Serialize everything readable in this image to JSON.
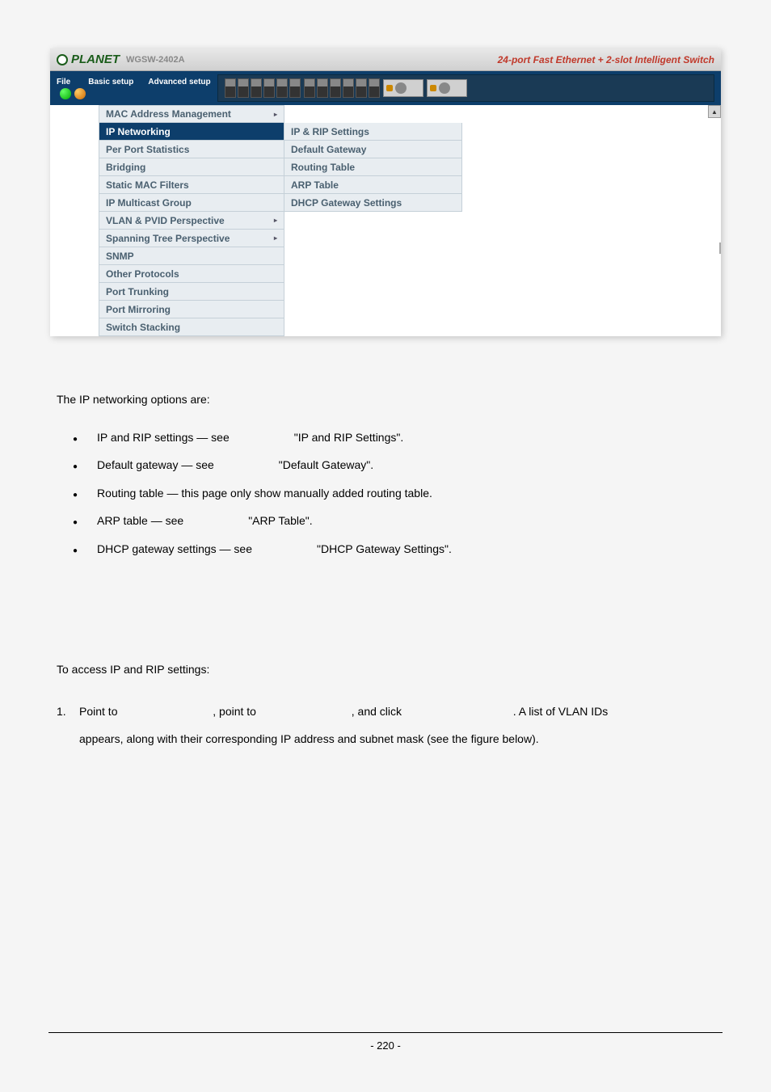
{
  "app": {
    "logo_text": "PLANET",
    "model": "WGSW-2402A",
    "tagline": "24-port Fast Ethernet + 2-slot Intelligent Switch",
    "menu_file": "File",
    "menu_basic": "Basic setup",
    "menu_advanced": "Advanced setup"
  },
  "menu": {
    "items": [
      {
        "label": "MAC Address Management",
        "has_sub": true,
        "highlighted": false
      },
      {
        "label": "IP Networking",
        "has_sub": false,
        "highlighted": true
      },
      {
        "label": "Per Port Statistics",
        "has_sub": false,
        "highlighted": false
      },
      {
        "label": "Bridging",
        "has_sub": false,
        "highlighted": false
      },
      {
        "label": "Static MAC Filters",
        "has_sub": false,
        "highlighted": false
      },
      {
        "label": "IP Multicast Group",
        "has_sub": false,
        "highlighted": false
      },
      {
        "label": "VLAN & PVID Perspective",
        "has_sub": true,
        "highlighted": false
      },
      {
        "label": "Spanning Tree Perspective",
        "has_sub": true,
        "highlighted": false
      },
      {
        "label": "SNMP",
        "has_sub": false,
        "highlighted": false
      },
      {
        "label": "Other Protocols",
        "has_sub": false,
        "highlighted": false
      },
      {
        "label": "Port Trunking",
        "has_sub": false,
        "highlighted": false
      },
      {
        "label": "Port Mirroring",
        "has_sub": false,
        "highlighted": false
      },
      {
        "label": "Switch Stacking",
        "has_sub": false,
        "highlighted": false
      }
    ]
  },
  "submenu": {
    "items": [
      {
        "label": "IP & RIP Settings"
      },
      {
        "label": "Default Gateway"
      },
      {
        "label": "Routing Table"
      },
      {
        "label": "ARP Table"
      },
      {
        "label": "DHCP Gateway Settings"
      }
    ]
  },
  "doc": {
    "intro": "The IP networking options are:",
    "bullets": [
      {
        "label": "IP and RIP settings — see",
        "ref": "\"IP and RIP Settings\"."
      },
      {
        "label": "Default gateway — see",
        "ref": "\"Default Gateway\"."
      },
      {
        "label": "Routing table — this page only show manually added routing table.",
        "ref": ""
      },
      {
        "label": "ARP table — see",
        "ref": "\"ARP Table\"."
      },
      {
        "label": "DHCP gateway settings — see",
        "ref": "\"DHCP Gateway Settings\"."
      }
    ],
    "subhead": "To access IP and RIP settings:",
    "step1_a": "Point to",
    "step1_b": ", point to",
    "step1_c": ", and click",
    "step1_d": ". A list of VLAN IDs",
    "step1_cont": "appears, along with their corresponding IP address and subnet mask (see the figure below).",
    "page_num": "- 220 -"
  }
}
